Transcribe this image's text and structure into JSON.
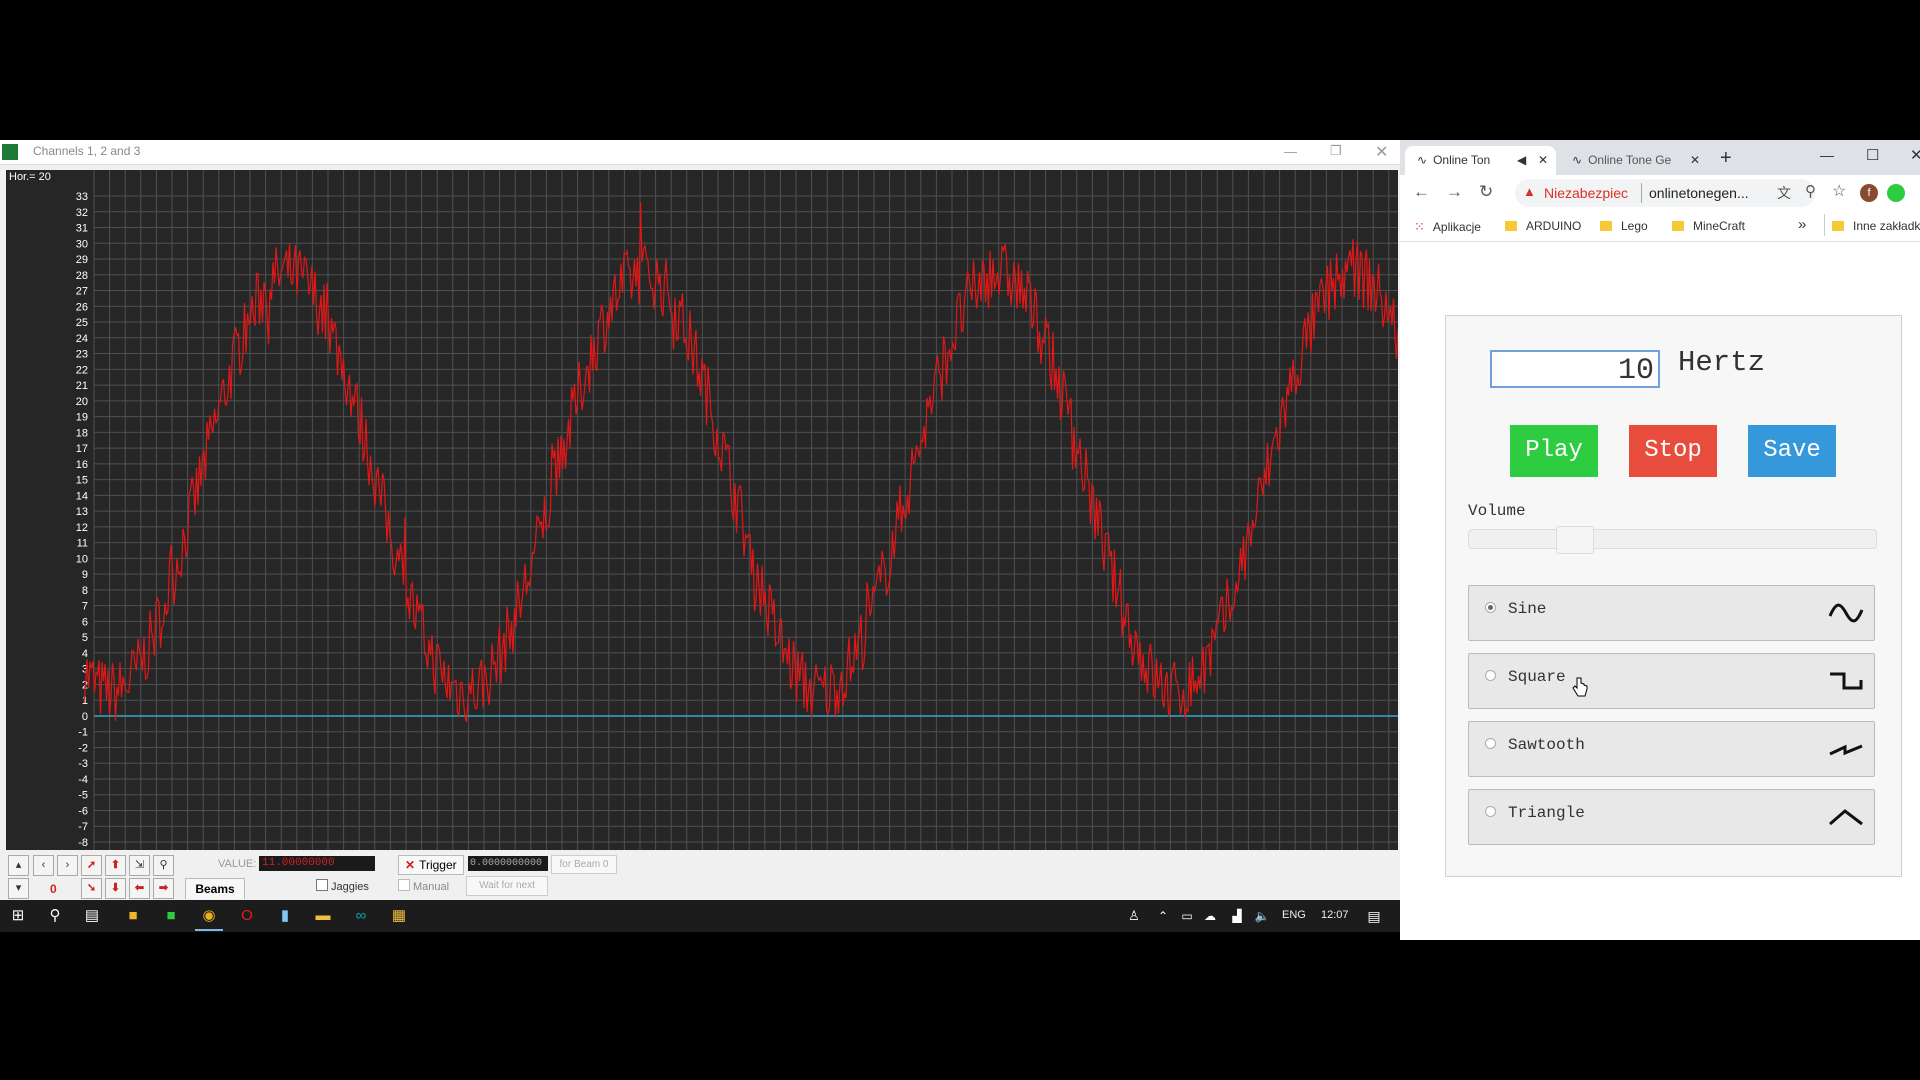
{
  "scope": {
    "title": "Channels 1, 2 and 3",
    "hor_label": "Hor.=  20",
    "y_ticks": [
      "33",
      "32",
      "31",
      "30",
      "29",
      "28",
      "27",
      "26",
      "25",
      "24",
      "23",
      "22",
      "21",
      "20",
      "19",
      "18",
      "17",
      "16",
      "15",
      "14",
      "13",
      "12",
      "11",
      "10",
      "9",
      "8",
      "7",
      "6",
      "5",
      "4",
      "3",
      "2",
      "1",
      "0",
      "-1",
      "-2",
      "-3",
      "-4",
      "-5",
      "-6",
      "-7",
      "-8"
    ],
    "toolbar": {
      "value_label": "VALUE:",
      "value": "11.00000000",
      "trigger_label": "Trigger",
      "trigger_value": "0.0000000000",
      "for_beam": "for Beam 0",
      "beams_tab": "Beams",
      "jaggies": "Jaggies",
      "manual": "Manual",
      "wait_next": "Wait for next",
      "counter": "0"
    },
    "colors": {
      "signal": "#e01818",
      "baseline": "#3aa7c9",
      "grid": "#505050"
    }
  },
  "taskbar": {
    "lang": "ENG",
    "time": "12:07",
    "icons": [
      "windows-start-icon",
      "search-icon",
      "task-view-icon",
      "app-icon-yellow",
      "app-icon-green",
      "chrome-icon",
      "opera-icon",
      "notepad-icon",
      "file-explorer-icon",
      "arduino-icon",
      "scope-app-icon"
    ]
  },
  "browser": {
    "tabs": [
      {
        "label": "Online Ton",
        "muted_icon": "speaker-icon",
        "active": true
      },
      {
        "label": "Online Tone Ge",
        "active": false
      }
    ],
    "address": {
      "warning": "Niezabezpiec",
      "url": "onlinetonegen..."
    },
    "bookmarks": [
      "Aplikacje",
      "ARDUINO",
      "Lego",
      "MineCraft",
      "Inne zakładk"
    ],
    "bookmarks_more": "»"
  },
  "tone": {
    "frequency": "10",
    "unit": "Hertz",
    "play": "Play",
    "stop": "Stop",
    "save": "Save",
    "volume_label": "Volume",
    "volume_level": 0.26,
    "waves": [
      {
        "label": "Sine",
        "selected": true,
        "icon": "sine-wave-icon"
      },
      {
        "label": "Square",
        "selected": false,
        "icon": "square-wave-icon"
      },
      {
        "label": "Sawtooth",
        "selected": false,
        "icon": "sawtooth-wave-icon"
      },
      {
        "label": "Triangle",
        "selected": false,
        "icon": "triangle-wave-icon"
      }
    ]
  }
}
